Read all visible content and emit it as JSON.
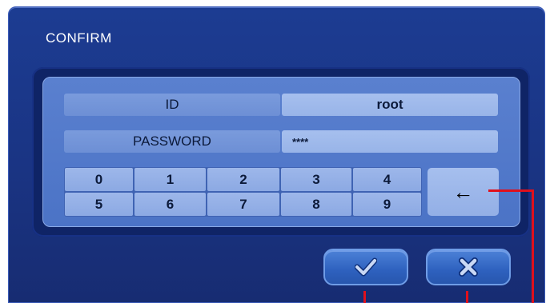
{
  "dialog": {
    "title": "CONFIRM",
    "id_label": "ID",
    "id_value": "root",
    "password_label": "PASSWORD",
    "password_value": "****",
    "backspace_symbol": "←",
    "keypad_rows": [
      [
        "0",
        "1",
        "2",
        "3",
        "4"
      ],
      [
        "5",
        "6",
        "7",
        "8",
        "9"
      ]
    ],
    "confirm_icon": "checkmark-icon",
    "cancel_icon": "x-icon"
  },
  "colors": {
    "background": "#1a3483",
    "panel": "#5077c9",
    "annotation_lines": "#e0101c"
  }
}
